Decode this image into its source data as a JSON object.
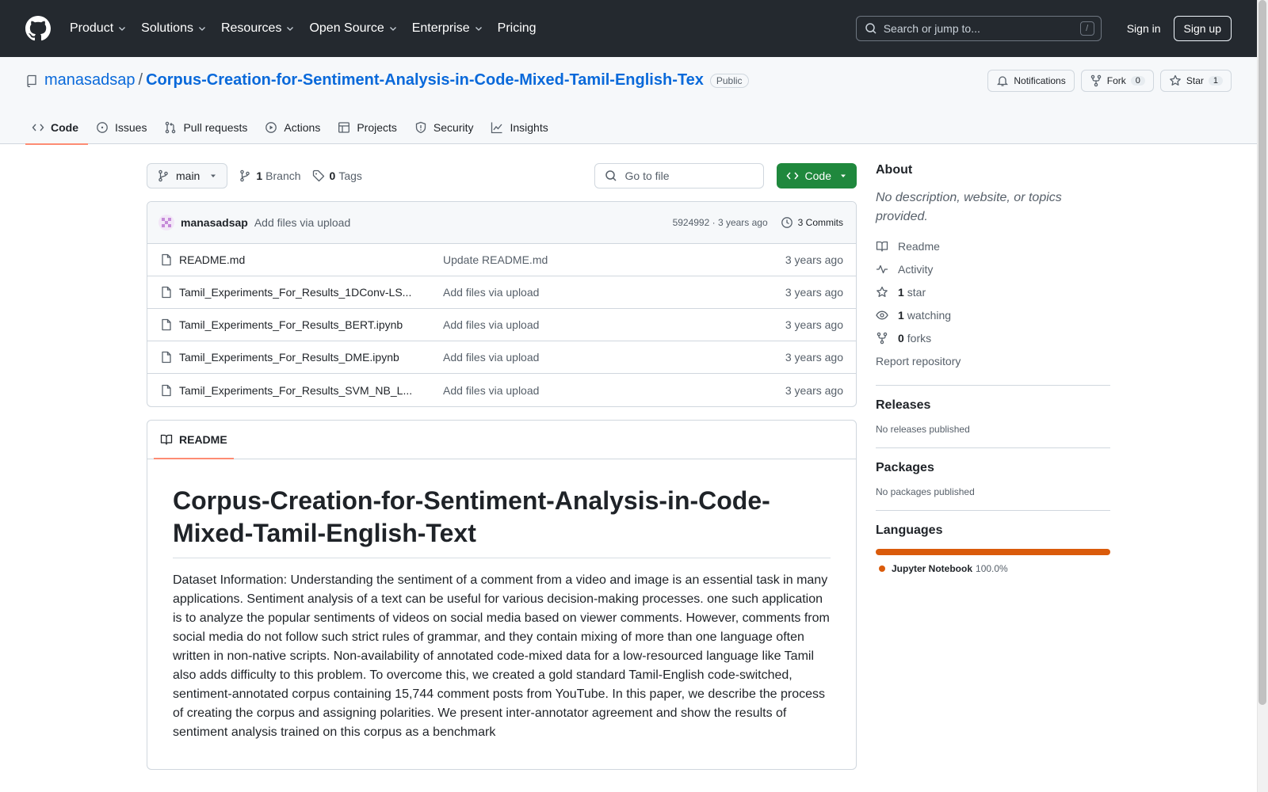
{
  "nav": {
    "items": [
      "Product",
      "Solutions",
      "Resources",
      "Open Source",
      "Enterprise",
      "Pricing"
    ],
    "search_placeholder": "Search or jump to...",
    "search_key": "/",
    "sign_in": "Sign in",
    "sign_up": "Sign up"
  },
  "repo": {
    "owner": "manasadsap",
    "separator": "/",
    "name": "Corpus-Creation-for-Sentiment-Analysis-in-Code-Mixed-Tamil-English-Tex",
    "visibility": "Public",
    "notifications_label": "Notifications",
    "fork_label": "Fork",
    "fork_count": "0",
    "star_label": "Star",
    "star_count": "1"
  },
  "tabs": [
    {
      "label": "Code",
      "icon": "code-icon",
      "active": true
    },
    {
      "label": "Issues",
      "icon": "issue-icon"
    },
    {
      "label": "Pull requests",
      "icon": "pull-request-icon"
    },
    {
      "label": "Actions",
      "icon": "play-icon"
    },
    {
      "label": "Projects",
      "icon": "table-icon"
    },
    {
      "label": "Security",
      "icon": "shield-icon"
    },
    {
      "label": "Insights",
      "icon": "graph-icon"
    }
  ],
  "toolbar": {
    "branch": "main",
    "branch_count": "1",
    "branch_label": "Branch",
    "tag_count": "0",
    "tag_label": "Tags",
    "go_to_file": "Go to file",
    "code_label": "Code"
  },
  "commit": {
    "author": "manasadsap",
    "message": "Add files via upload",
    "meta": "5924992 · 3 years ago",
    "commits_label": "3 Commits"
  },
  "files": [
    {
      "name": "README.md",
      "message": "Update README.md",
      "time": "3 years ago"
    },
    {
      "name": "Tamil_Experiments_For_Results_1DConv-LS...",
      "message": "Add files via upload",
      "time": "3 years ago"
    },
    {
      "name": "Tamil_Experiments_For_Results_BERT.ipynb",
      "message": "Add files via upload",
      "time": "3 years ago"
    },
    {
      "name": "Tamil_Experiments_For_Results_DME.ipynb",
      "message": "Add files via upload",
      "time": "3 years ago"
    },
    {
      "name": "Tamil_Experiments_For_Results_SVM_NB_L...",
      "message": "Add files via upload",
      "time": "3 years ago"
    }
  ],
  "readme": {
    "tab_label": "README",
    "title": "Corpus-Creation-for-Sentiment-Analysis-in-Code-Mixed-Tamil-English-Text",
    "body": "Dataset Information: Understanding the sentiment of a comment from a video and image is an essential task in many applications. Sentiment analysis of a text can be useful for various decision-making processes. one such application is to analyze the popular sentiments of videos on social media based on viewer comments. However, comments from social media do not follow such strict rules of grammar, and they contain mixing of more than one language often written in non-native scripts. Non-availability of annotated code-mixed data for a low-resourced language like Tamil also adds difficulty to this problem. To overcome this, we created a gold standard Tamil-English code-switched, sentiment-annotated corpus containing 15,744 comment posts from YouTube. In this paper, we describe the process of creating the corpus and assigning polarities. We present inter-annotator agreement and show the results of sentiment analysis trained on this corpus as a benchmark"
  },
  "about": {
    "title": "About",
    "description": "No description, website, or topics provided.",
    "readme": "Readme",
    "activity": "Activity",
    "stars_count": "1",
    "stars_label": "star",
    "watching_count": "1",
    "watching_label": "watching",
    "forks_count": "0",
    "forks_label": "forks",
    "report": "Report repository"
  },
  "releases": {
    "title": "Releases",
    "empty": "No releases published"
  },
  "packages": {
    "title": "Packages",
    "empty": "No packages published"
  },
  "languages": {
    "title": "Languages",
    "items": [
      {
        "name": "Jupyter Notebook",
        "percent": "100.0%",
        "color": "#DA5B0B"
      }
    ]
  }
}
